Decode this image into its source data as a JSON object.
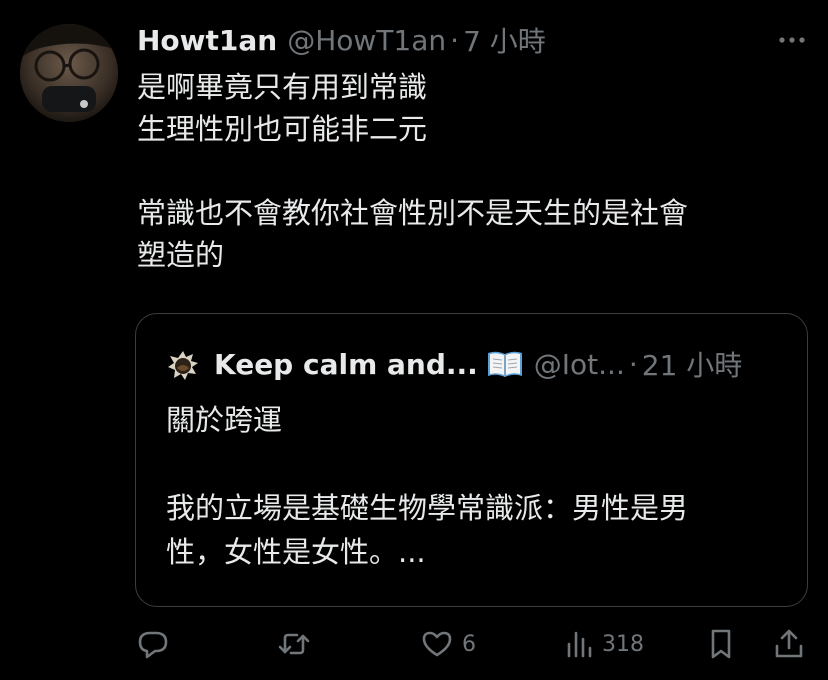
{
  "tweet": {
    "display_name": "Howt1an",
    "handle": "@HowT1an",
    "separator": "·",
    "time": "7 小時",
    "lines": [
      "是啊畢竟只有用到常識",
      "生理性別也可能非二元",
      "",
      "常識也不會教你社會性別不是天生的是社會",
      "塑造的"
    ]
  },
  "quote": {
    "display_name": "Keep calm and...",
    "handle": "@Iot...",
    "separator": "·",
    "time": "21 小時",
    "lines": [
      "關於跨運",
      "",
      "我的立場是基礎生物學常識派：男性是男",
      "性，女性是女性。..."
    ]
  },
  "actions": {
    "reply_count": "",
    "retweet_count": "",
    "like_count": "6",
    "views_count": "318"
  },
  "colors": {
    "background": "#000000",
    "text": "#e7e9ea",
    "muted": "#71767b",
    "border": "#3a3d41"
  },
  "icons": [
    "more-icon",
    "reply-icon",
    "retweet-icon",
    "like-icon",
    "views-icon",
    "bookmark-icon",
    "share-icon",
    "book-emoji-icon"
  ]
}
